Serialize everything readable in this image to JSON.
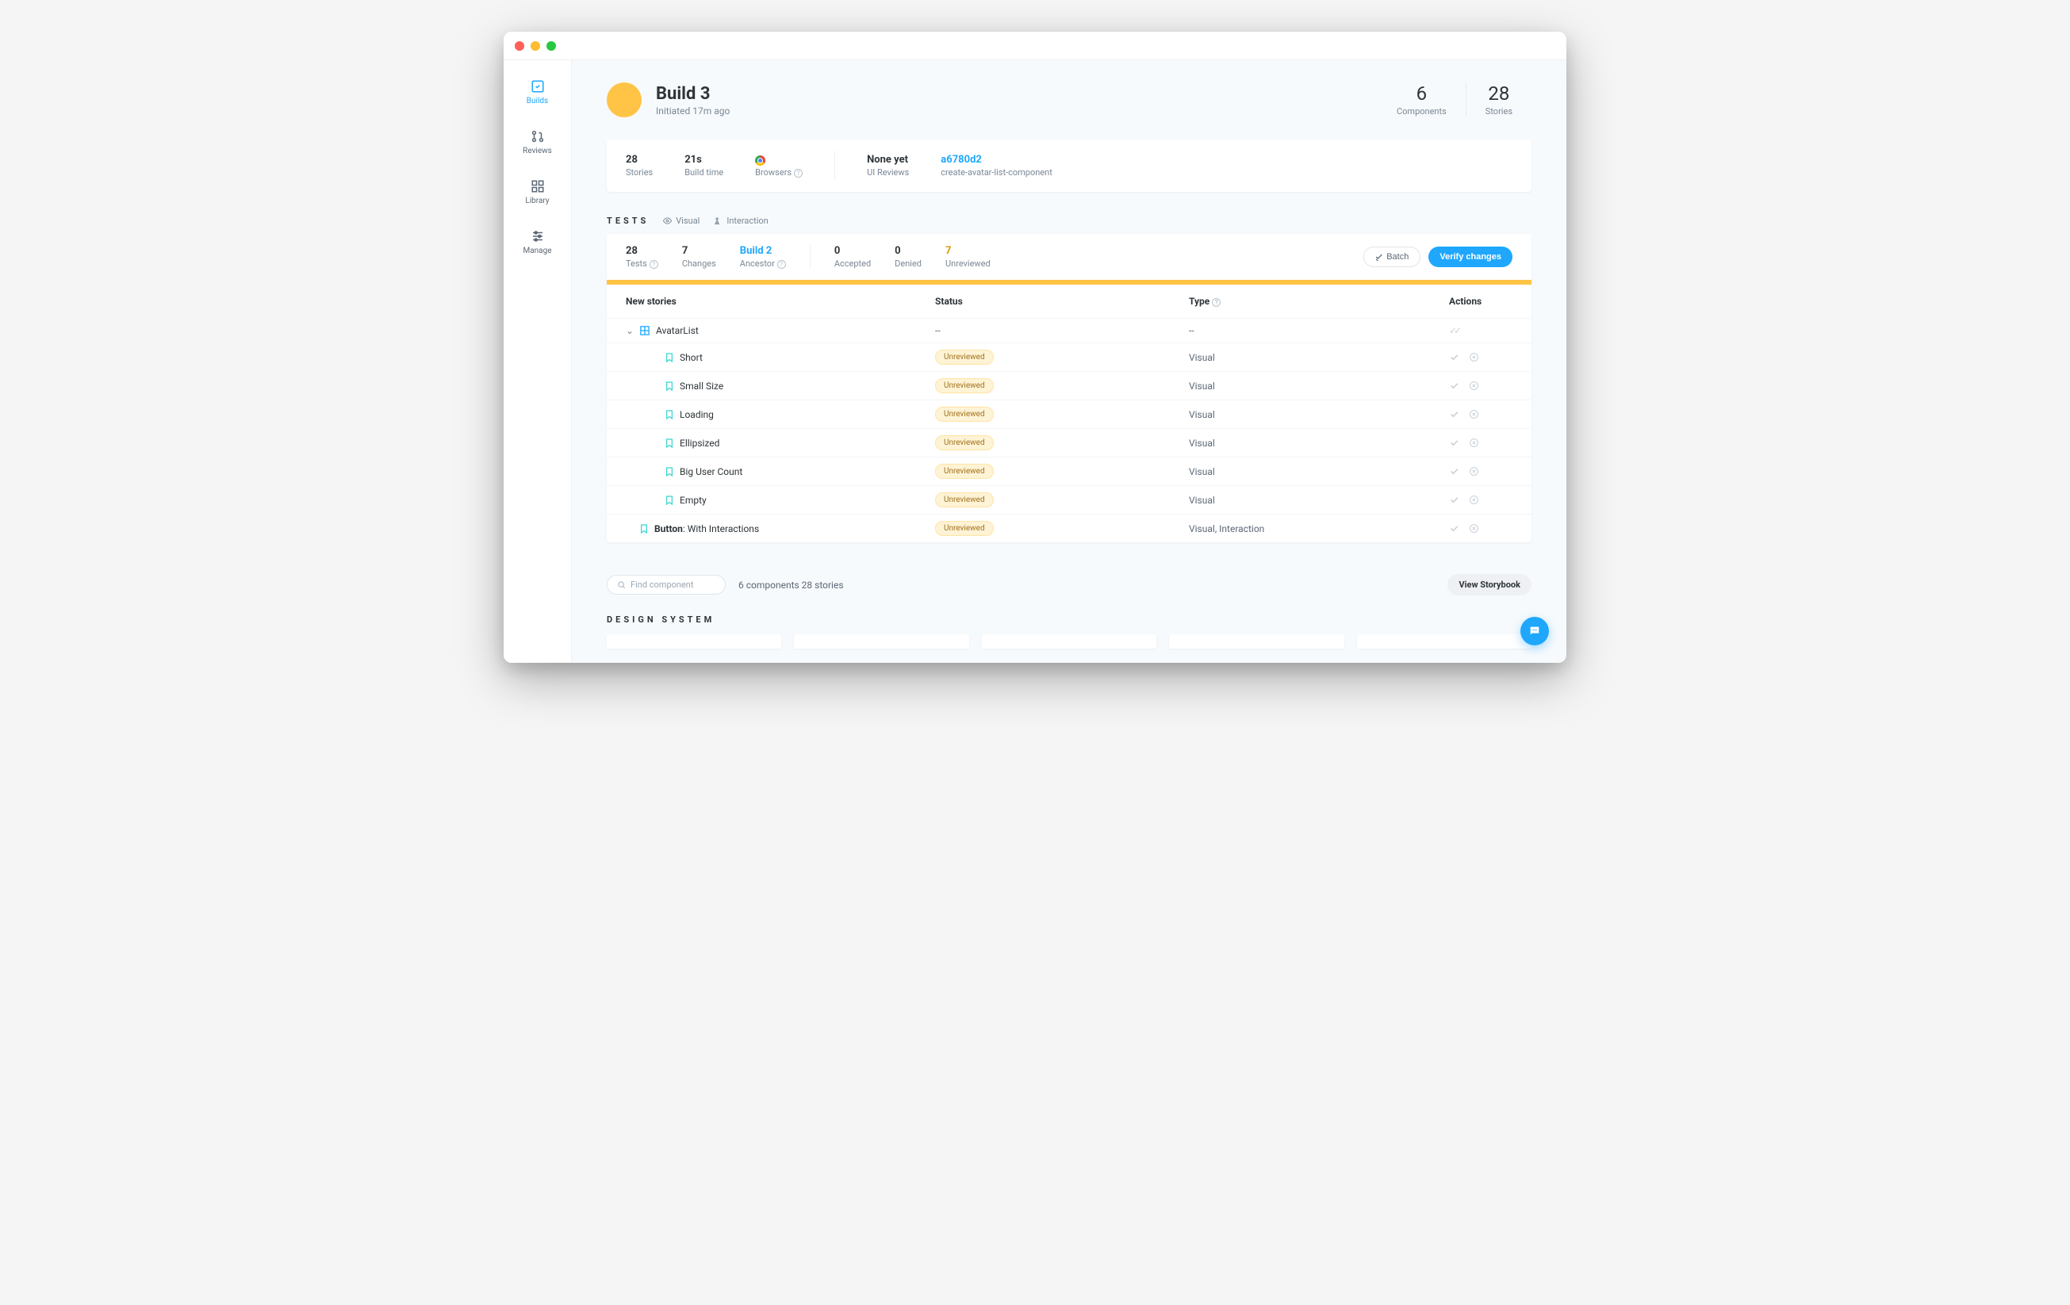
{
  "sidebar": {
    "items": [
      {
        "label": "Builds",
        "icon": "check-square",
        "active": true
      },
      {
        "label": "Reviews",
        "icon": "pull-request",
        "active": false
      },
      {
        "label": "Library",
        "icon": "grid",
        "active": false
      },
      {
        "label": "Manage",
        "icon": "sliders",
        "active": false
      }
    ]
  },
  "header": {
    "title": "Build 3",
    "subtitle": "Initiated 17m ago",
    "stats": [
      {
        "num": "6",
        "label": "Components"
      },
      {
        "num": "28",
        "label": "Stories"
      }
    ]
  },
  "info": {
    "stories": {
      "val": "28",
      "label": "Stories"
    },
    "build_time": {
      "val": "21s",
      "label": "Build time"
    },
    "browsers": {
      "label": "Browsers"
    },
    "ui_reviews": {
      "val": "None yet",
      "label": "UI Reviews"
    },
    "commit": {
      "val": "a6780d2",
      "label": "create-avatar-list-component"
    }
  },
  "tests_header": {
    "title": "TESTS",
    "tags": [
      "Visual",
      "Interaction"
    ]
  },
  "tests_summary": {
    "tests": {
      "val": "28",
      "label": "Tests"
    },
    "changes": {
      "val": "7",
      "label": "Changes"
    },
    "ancestor": {
      "val": "Build 2",
      "label": "Ancestor"
    },
    "accepted": {
      "val": "0",
      "label": "Accepted"
    },
    "denied": {
      "val": "0",
      "label": "Denied"
    },
    "unreviewed": {
      "val": "7",
      "label": "Unreviewed"
    },
    "batch_label": "Batch",
    "verify_label": "Verify changes"
  },
  "table": {
    "headers": {
      "name": "New stories",
      "status": "Status",
      "type": "Type",
      "actions": "Actions"
    },
    "group": {
      "name": "AvatarList",
      "status": "--",
      "type": "--"
    },
    "rows": [
      {
        "name": "Short",
        "status": "Unreviewed",
        "type": "Visual"
      },
      {
        "name": "Small Size",
        "status": "Unreviewed",
        "type": "Visual"
      },
      {
        "name": "Loading",
        "status": "Unreviewed",
        "type": "Visual"
      },
      {
        "name": "Ellipsized",
        "status": "Unreviewed",
        "type": "Visual"
      },
      {
        "name": "Big User Count",
        "status": "Unreviewed",
        "type": "Visual"
      },
      {
        "name": "Empty",
        "status": "Unreviewed",
        "type": "Visual"
      }
    ],
    "extra_row": {
      "component": "Button",
      "story": ": With Interactions",
      "status": "Unreviewed",
      "type": "Visual, Interaction"
    }
  },
  "footer": {
    "search_placeholder": "Find component",
    "counts": "6 components   28 stories",
    "view_sb": "View Storybook"
  },
  "design_title": "DESIGN SYSTEM"
}
